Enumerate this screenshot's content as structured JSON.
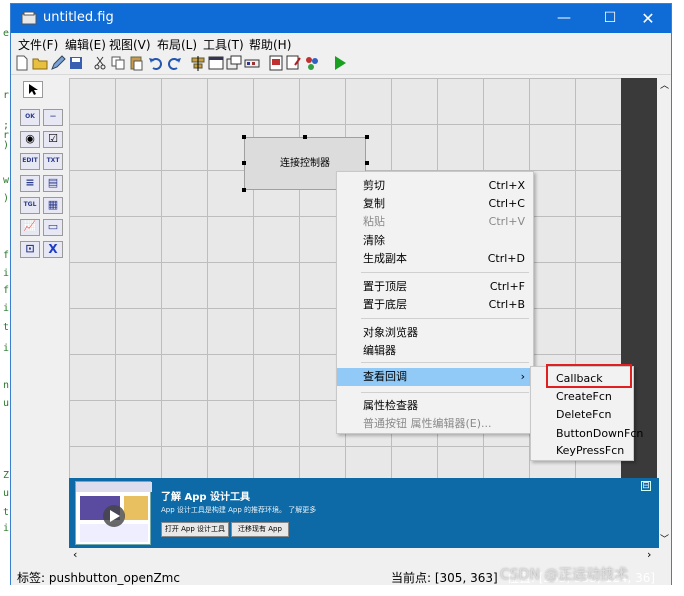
{
  "window": {
    "title": "untitled.fig"
  },
  "editor_margin": [
    "e",
    "r",
    ";",
    "r",
    ")",
    "w",
    ")",
    "f",
    "i",
    "f",
    "i",
    "t",
    "i",
    "n",
    "u",
    "Z",
    "u",
    "t",
    "i"
  ],
  "menu": [
    "文件(F)",
    "编辑(E)",
    "视图(V)",
    "布局(L)",
    "工具(T)",
    "帮助(H)"
  ],
  "palette": [
    [
      "arrow-select",
      null
    ],
    [
      "pushbutton",
      "OK"
    ],
    [
      "slider",
      "—"
    ],
    [
      "radio",
      "◉"
    ],
    [
      "checkbox",
      "☑"
    ],
    [
      "edit-text",
      "EDIT"
    ],
    [
      "static-text",
      "TXT"
    ],
    [
      "popup-menu",
      "≡"
    ],
    [
      "listbox",
      "▤"
    ],
    [
      "toggle",
      "TGL"
    ],
    [
      "table",
      "▦"
    ],
    [
      "axes",
      "📈"
    ],
    [
      "panel",
      "▭"
    ],
    [
      "button-group",
      "⊡"
    ],
    [
      "activex",
      "X"
    ]
  ],
  "figure_control": {
    "label": "连接控制器"
  },
  "context_menu": {
    "items": [
      {
        "label": "剪切",
        "key": "Ctrl+X",
        "disabled": false
      },
      {
        "label": "复制",
        "key": "Ctrl+C",
        "disabled": false
      },
      {
        "label": "粘贴",
        "key": "Ctrl+V",
        "disabled": true
      },
      {
        "label": "清除",
        "key": "",
        "disabled": false
      },
      {
        "label": "生成副本",
        "key": "Ctrl+D",
        "disabled": false
      },
      {
        "label": "置于顶层",
        "key": "Ctrl+F",
        "disabled": false
      },
      {
        "label": "置于底层",
        "key": "Ctrl+B",
        "disabled": false
      },
      {
        "label": "对象浏览器",
        "key": "",
        "disabled": false
      },
      {
        "label": "编辑器",
        "key": "",
        "disabled": false
      },
      {
        "label": "查看回调",
        "key": "›",
        "disabled": false,
        "highlighted": true
      },
      {
        "label": "属性检查器",
        "key": "",
        "disabled": false
      },
      {
        "label": "普通按钮 属性编辑器(E)...",
        "key": "",
        "disabled": true
      }
    ]
  },
  "submenu": {
    "items": [
      "Callback",
      "CreateFcn",
      "DeleteFcn",
      "ButtonDownFcn",
      "KeyPressFcn"
    ]
  },
  "banner": {
    "title": "了解 App 设计工具",
    "text": "App 设计工具是构建 App 的推荐环境。 了解更多",
    "btn1": "打开 App 设计工具",
    "btn2": "迁移现有 App",
    "collapse": "⊟"
  },
  "status": {
    "tag": "标签: pushbutton_openZmc",
    "point": "当前点:  [305, 363]",
    "position": "位置: [253, 353, 124, 36]"
  },
  "watermark": "CSDN @正运动技术",
  "colors": {
    "titlebar": "#0f6bd6",
    "highlight": "#91c9f7",
    "callback_box": "#e02020",
    "banner": "#0d6aa6"
  }
}
